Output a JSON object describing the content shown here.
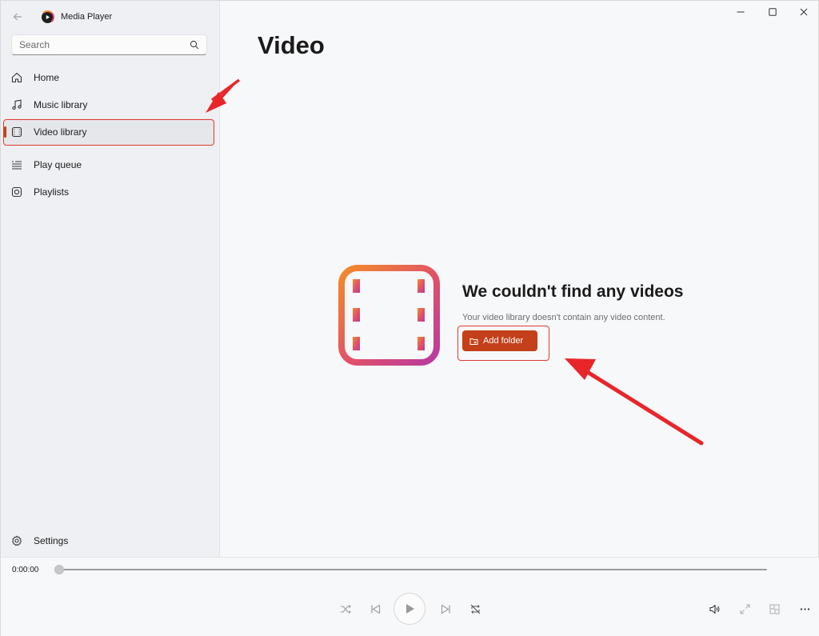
{
  "app": {
    "title": "Media Player"
  },
  "search": {
    "placeholder": "Search"
  },
  "sidebar": {
    "items": [
      {
        "label": "Home",
        "icon": "home-icon"
      },
      {
        "label": "Music library",
        "icon": "music-note-icon"
      },
      {
        "label": "Video library",
        "icon": "film-icon",
        "active": true
      },
      {
        "label": "Play queue",
        "icon": "queue-list-icon"
      },
      {
        "label": "Playlists",
        "icon": "playlist-icon"
      }
    ],
    "settings_label": "Settings"
  },
  "main": {
    "page_title": "Video",
    "empty_heading": "We couldn't find any videos",
    "empty_subtext": "Your video library doesn't contain any video content.",
    "add_folder_label": "Add folder"
  },
  "player": {
    "current_time": "0:00:00",
    "progress": 0
  },
  "colors": {
    "accent": "#c3401a",
    "annotation": "#e23a2e",
    "gradient_start": "#f28c28",
    "gradient_end": "#b83aa0"
  }
}
